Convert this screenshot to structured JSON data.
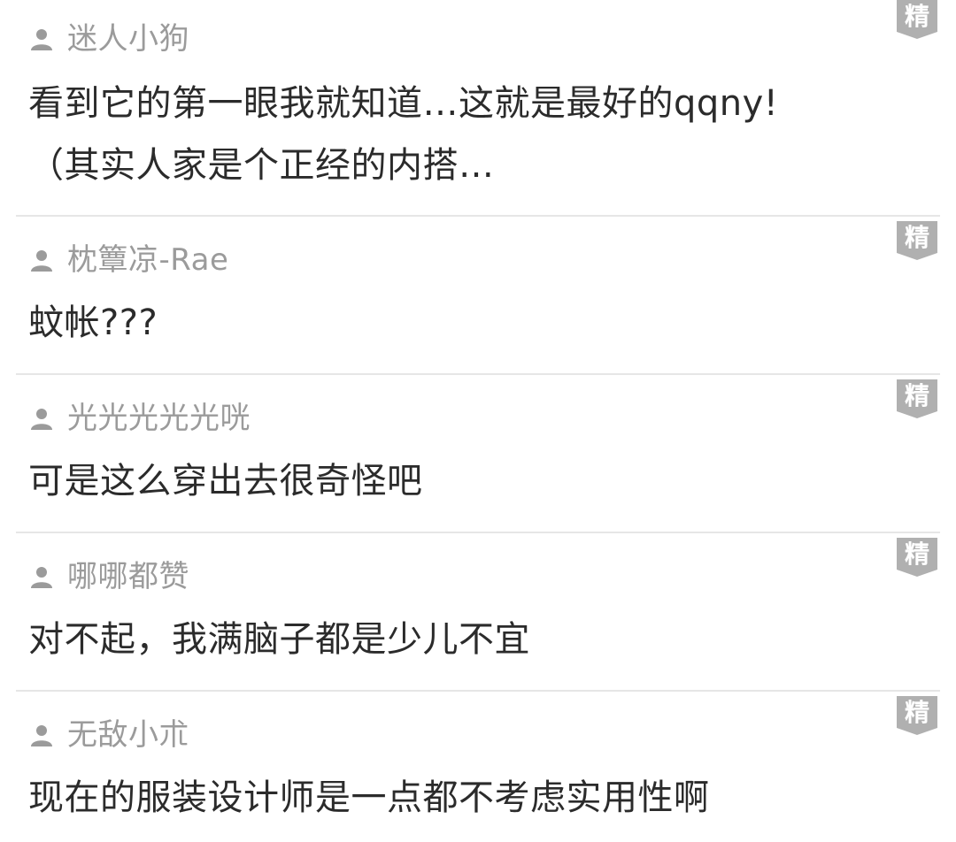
{
  "colors": {
    "author": "#9b9b9b",
    "text": "#2b2b2b",
    "divider": "#e6e6e6",
    "badge": "#b0b0b0"
  },
  "badge_icon": "featured-badge",
  "author_icon": "user-icon",
  "comments": [
    {
      "author": "迷人小狗",
      "text": "看到它的第一眼我就知道…这就是最好的qqny!\n（其实人家是个正经的内搭…",
      "badge": "精"
    },
    {
      "author": "枕簟凉-Rae",
      "text": "蚊帐???",
      "badge": "精"
    },
    {
      "author": " 光光光光光咣",
      "text": "可是这么穿出去很奇怪吧",
      "badge": "精"
    },
    {
      "author": "哪哪都赞",
      "text": "对不起，我满脑子都是少儿不宜",
      "badge": "精"
    },
    {
      "author": "无敌小朮",
      "text": "现在的服装设计师是一点都不考虑实用性啊",
      "badge": "精"
    }
  ]
}
